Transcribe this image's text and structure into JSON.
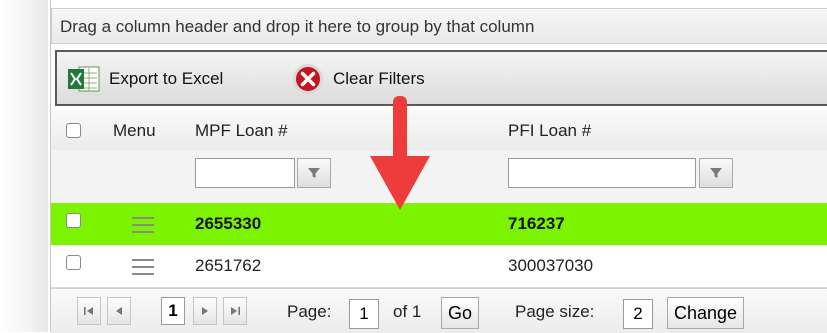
{
  "group_bar": {
    "text": "Drag a column header and drop it here to group by that column"
  },
  "toolbar": {
    "export_label": "Export to Excel",
    "clear_label": "Clear Filters"
  },
  "columns": {
    "menu": "Menu",
    "mpf": "MPF Loan #",
    "pfi": "PFI Loan #"
  },
  "rows": [
    {
      "mpf": "2655330",
      "pfi": "716237",
      "highlighted": true
    },
    {
      "mpf": "2651762",
      "pfi": "300037030",
      "highlighted": false
    }
  ],
  "pager": {
    "current_page_button": "1",
    "page_label": "Page:",
    "page_value": "1",
    "of_label": "of 1",
    "go_label": "Go",
    "size_label": "Page size:",
    "size_value": "2",
    "change_label": "Change"
  },
  "colors": {
    "highlight_row": "#7cf400",
    "annotation_arrow": "#ee3b3b"
  },
  "icons": {
    "excel": "excel-icon",
    "clear": "clear-filter-icon",
    "filter": "funnel-icon",
    "menu": "hamburger-icon",
    "first": "first-page-icon",
    "prev": "prev-page-icon",
    "next": "next-page-icon",
    "last": "last-page-icon"
  }
}
